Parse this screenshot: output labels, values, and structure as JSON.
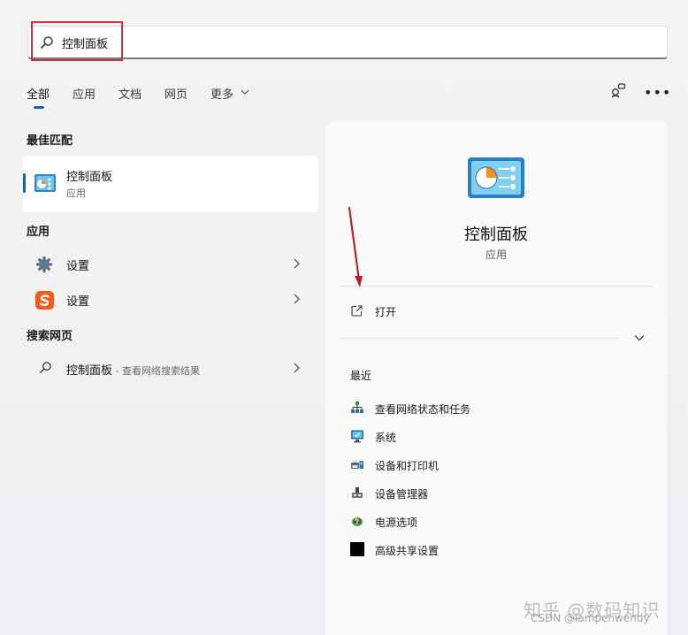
{
  "search": {
    "query": "控制面板"
  },
  "tabs": [
    {
      "label": "全部"
    },
    {
      "label": "应用"
    },
    {
      "label": "文档"
    },
    {
      "label": "网页"
    },
    {
      "label": "更多"
    }
  ],
  "sections": {
    "best_match": "最佳匹配",
    "apps": "应用",
    "web": "搜索网页"
  },
  "best_match": {
    "title": "控制面板",
    "subtitle": "应用"
  },
  "apps": [
    {
      "label": "设置",
      "icon": "settings-gear-icon"
    },
    {
      "label": "设置",
      "icon": "sogou-s-icon"
    }
  ],
  "web_result": {
    "title": "控制面板",
    "suffix": " - 查看网络搜索结果"
  },
  "detail": {
    "title": "控制面板",
    "subtitle": "应用",
    "open_label": "打开",
    "recent_label": "最近",
    "recent_items": [
      {
        "label": "查看网络状态和任务",
        "icon": "network-icon"
      },
      {
        "label": "系统",
        "icon": "monitor-icon"
      },
      {
        "label": "设备和打印机",
        "icon": "printer-icon"
      },
      {
        "label": "设备管理器",
        "icon": "device-manager-icon"
      },
      {
        "label": "电源选项",
        "icon": "power-options-icon"
      },
      {
        "label": "高级共享设置",
        "icon": "sharing-settings-icon"
      }
    ]
  },
  "watermark": {
    "line1": "知乎 @数码知识",
    "line2": "CSDN @lampenwendy"
  },
  "colors": {
    "accent": "#1f5fa8",
    "highlight_box": "#c8323c",
    "arrow": "#b8232b"
  }
}
